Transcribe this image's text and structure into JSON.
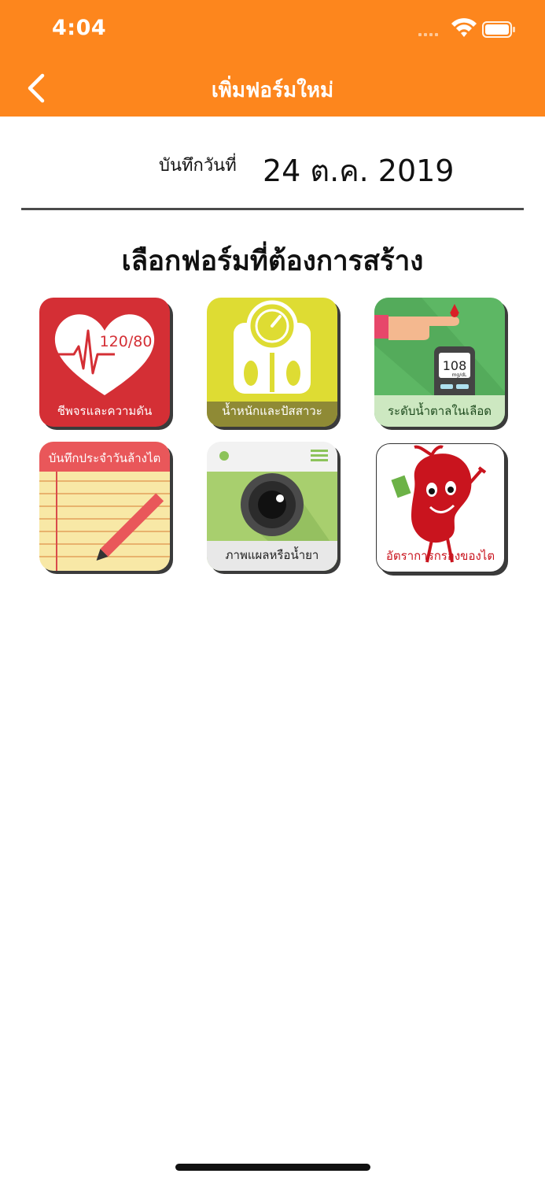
{
  "status_bar": {
    "time": "4:04"
  },
  "nav": {
    "title": "เพิ่มฟอร์มใหม่",
    "back_icon": "chevron-left-icon"
  },
  "record": {
    "label": "บันทึกวันที่",
    "date": "24 ต.ค. 2019"
  },
  "section_title": "เลือกฟอร์มที่ต้องการสร้าง",
  "forms": [
    {
      "label": "ชีพจรและความดัน",
      "icon": "heart-pulse-icon",
      "badge_text": "120/80",
      "color": "#d42f35"
    },
    {
      "label": "น้ำหนักและปัสสาวะ",
      "icon": "weighing-scale-icon",
      "color": "#dedc33"
    },
    {
      "label": "ระดับน้ำตาลในเลือด",
      "icon": "glucose-meter-icon",
      "reading": "108",
      "unit": "mg/dL",
      "color": "#5db764"
    },
    {
      "label": "บันทึกประจำวันล้างไต",
      "icon": "notepad-pencil-icon",
      "color": "#f8e8a6"
    },
    {
      "label": "ภาพแผลหรือน้ำยา",
      "icon": "camera-icon",
      "color": "#a8cf6e"
    },
    {
      "label": "อัตราการกรองของไต",
      "icon": "kidney-mascot-icon",
      "color": "#ffffff"
    }
  ],
  "colors": {
    "brand": "#fd861d",
    "text": "#111111"
  }
}
